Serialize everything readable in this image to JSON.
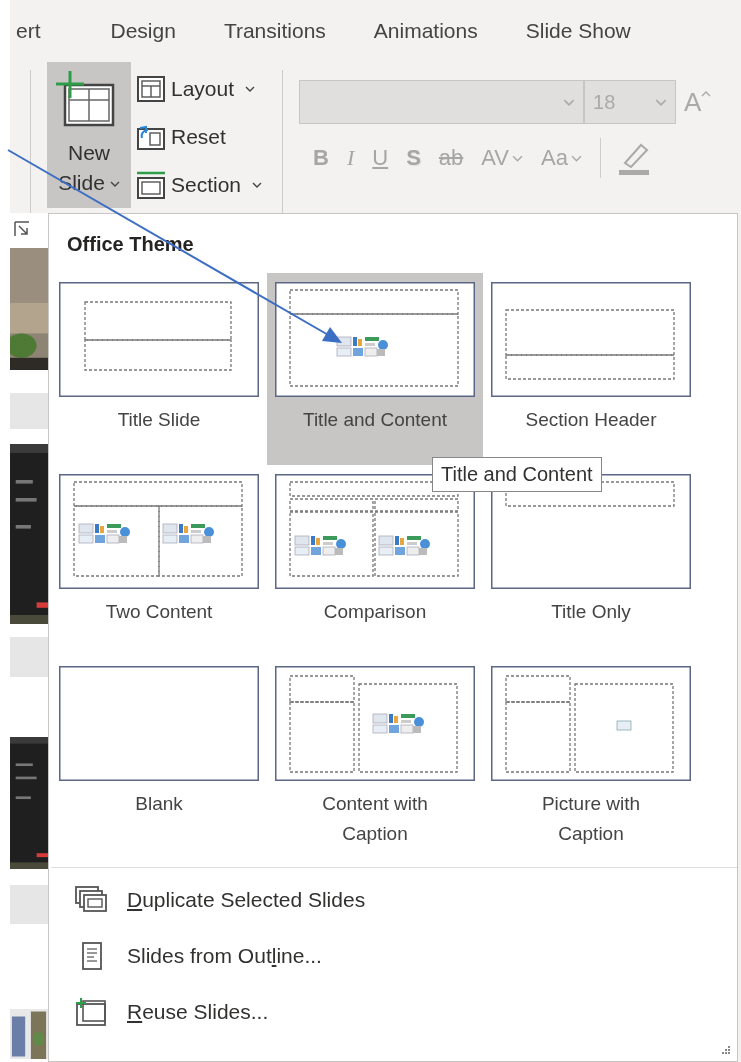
{
  "tabs": [
    {
      "label": "ert"
    },
    {
      "label": "Design"
    },
    {
      "label": "Transitions"
    },
    {
      "label": "Animations"
    },
    {
      "label": "Slide Show"
    }
  ],
  "ribbon": {
    "new_slide": {
      "label": "New Slide",
      "pressed": true
    },
    "small_buttons": [
      {
        "label": "Layout",
        "has_menu": true
      },
      {
        "label": "Reset",
        "has_menu": false
      },
      {
        "label": "Section",
        "has_menu": true
      }
    ],
    "font": {
      "disabled": true,
      "size": "18",
      "grow_label": "A",
      "format_buttons": [
        {
          "kind": "bold",
          "label": "B"
        },
        {
          "kind": "italic",
          "label": "I"
        },
        {
          "kind": "underline",
          "label": "U"
        },
        {
          "kind": "shadow",
          "label": "S"
        },
        {
          "kind": "strike",
          "label": "ab"
        },
        {
          "kind": "spacing",
          "label": "AV"
        },
        {
          "kind": "case",
          "label": "Aa"
        }
      ]
    }
  },
  "menu": {
    "title": "Office Theme",
    "layouts": [
      {
        "kind": "title",
        "label": "Title Slide",
        "selected": false
      },
      {
        "kind": "title_content",
        "label": "Title and Content",
        "selected": true
      },
      {
        "kind": "section",
        "label": "Section Header",
        "selected": false
      },
      {
        "kind": "two_content",
        "label": "Two Content",
        "selected": false
      },
      {
        "kind": "comparison",
        "label": "Comparison",
        "selected": false
      },
      {
        "kind": "title_only",
        "label": "Title Only",
        "selected": false
      },
      {
        "kind": "blank",
        "label": "Blank",
        "selected": false
      },
      {
        "kind": "content_caption",
        "label": "Content with Caption",
        "selected": false
      },
      {
        "kind": "picture_caption",
        "label": "Picture with Caption",
        "selected": false
      }
    ],
    "items": [
      {
        "access_key": "D",
        "text_after": "uplicate Selected Slides"
      },
      {
        "text_before": "Slides from Out",
        "access_key": "l",
        "text_after": "ine..."
      },
      {
        "access_key": "R",
        "text_after": "euse Slides..."
      }
    ]
  },
  "tooltip": "Title and Content"
}
